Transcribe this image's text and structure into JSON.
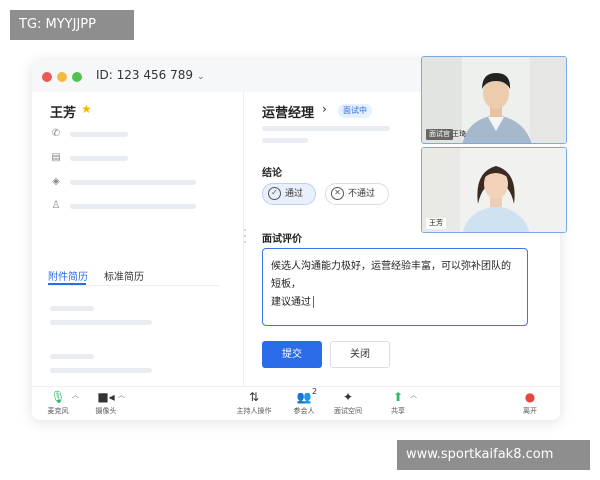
{
  "watermark_top": "TG: MYYJJPP",
  "watermark_bottom": "www.sportkaifak8.com",
  "window": {
    "meeting_id": "ID: 123 456 789"
  },
  "candidate": {
    "name": "王芳",
    "tabs": [
      "附件简历",
      "标准简历"
    ]
  },
  "review": {
    "job_title": "运营经理",
    "status": "面试中",
    "conclusion_label": "结论",
    "pass_label": "通过",
    "fail_label": "不通过",
    "evaluation_label": "面试评价",
    "evaluation_line1": "候选人沟通能力极好，运营经验丰富，可以弥补团队的短板，",
    "evaluation_line2": "建议通过",
    "submit_label": "提交",
    "close_label": "关闭"
  },
  "toolbar": {
    "mic": "麦克风",
    "camera": "摄像头",
    "host": "主持人操作",
    "participants": "参会人",
    "participants_count": "2",
    "interview_space": "面试空间",
    "share": "共享",
    "leave": "离开"
  },
  "videos": {
    "interviewer_role": "面试官",
    "interviewer_name": "王琦",
    "candidate_name": "王芳"
  },
  "colors": {
    "accent": "#2b6de8",
    "leave": "#e8453c",
    "share": "#2fb866",
    "mic": "#2fb866"
  }
}
